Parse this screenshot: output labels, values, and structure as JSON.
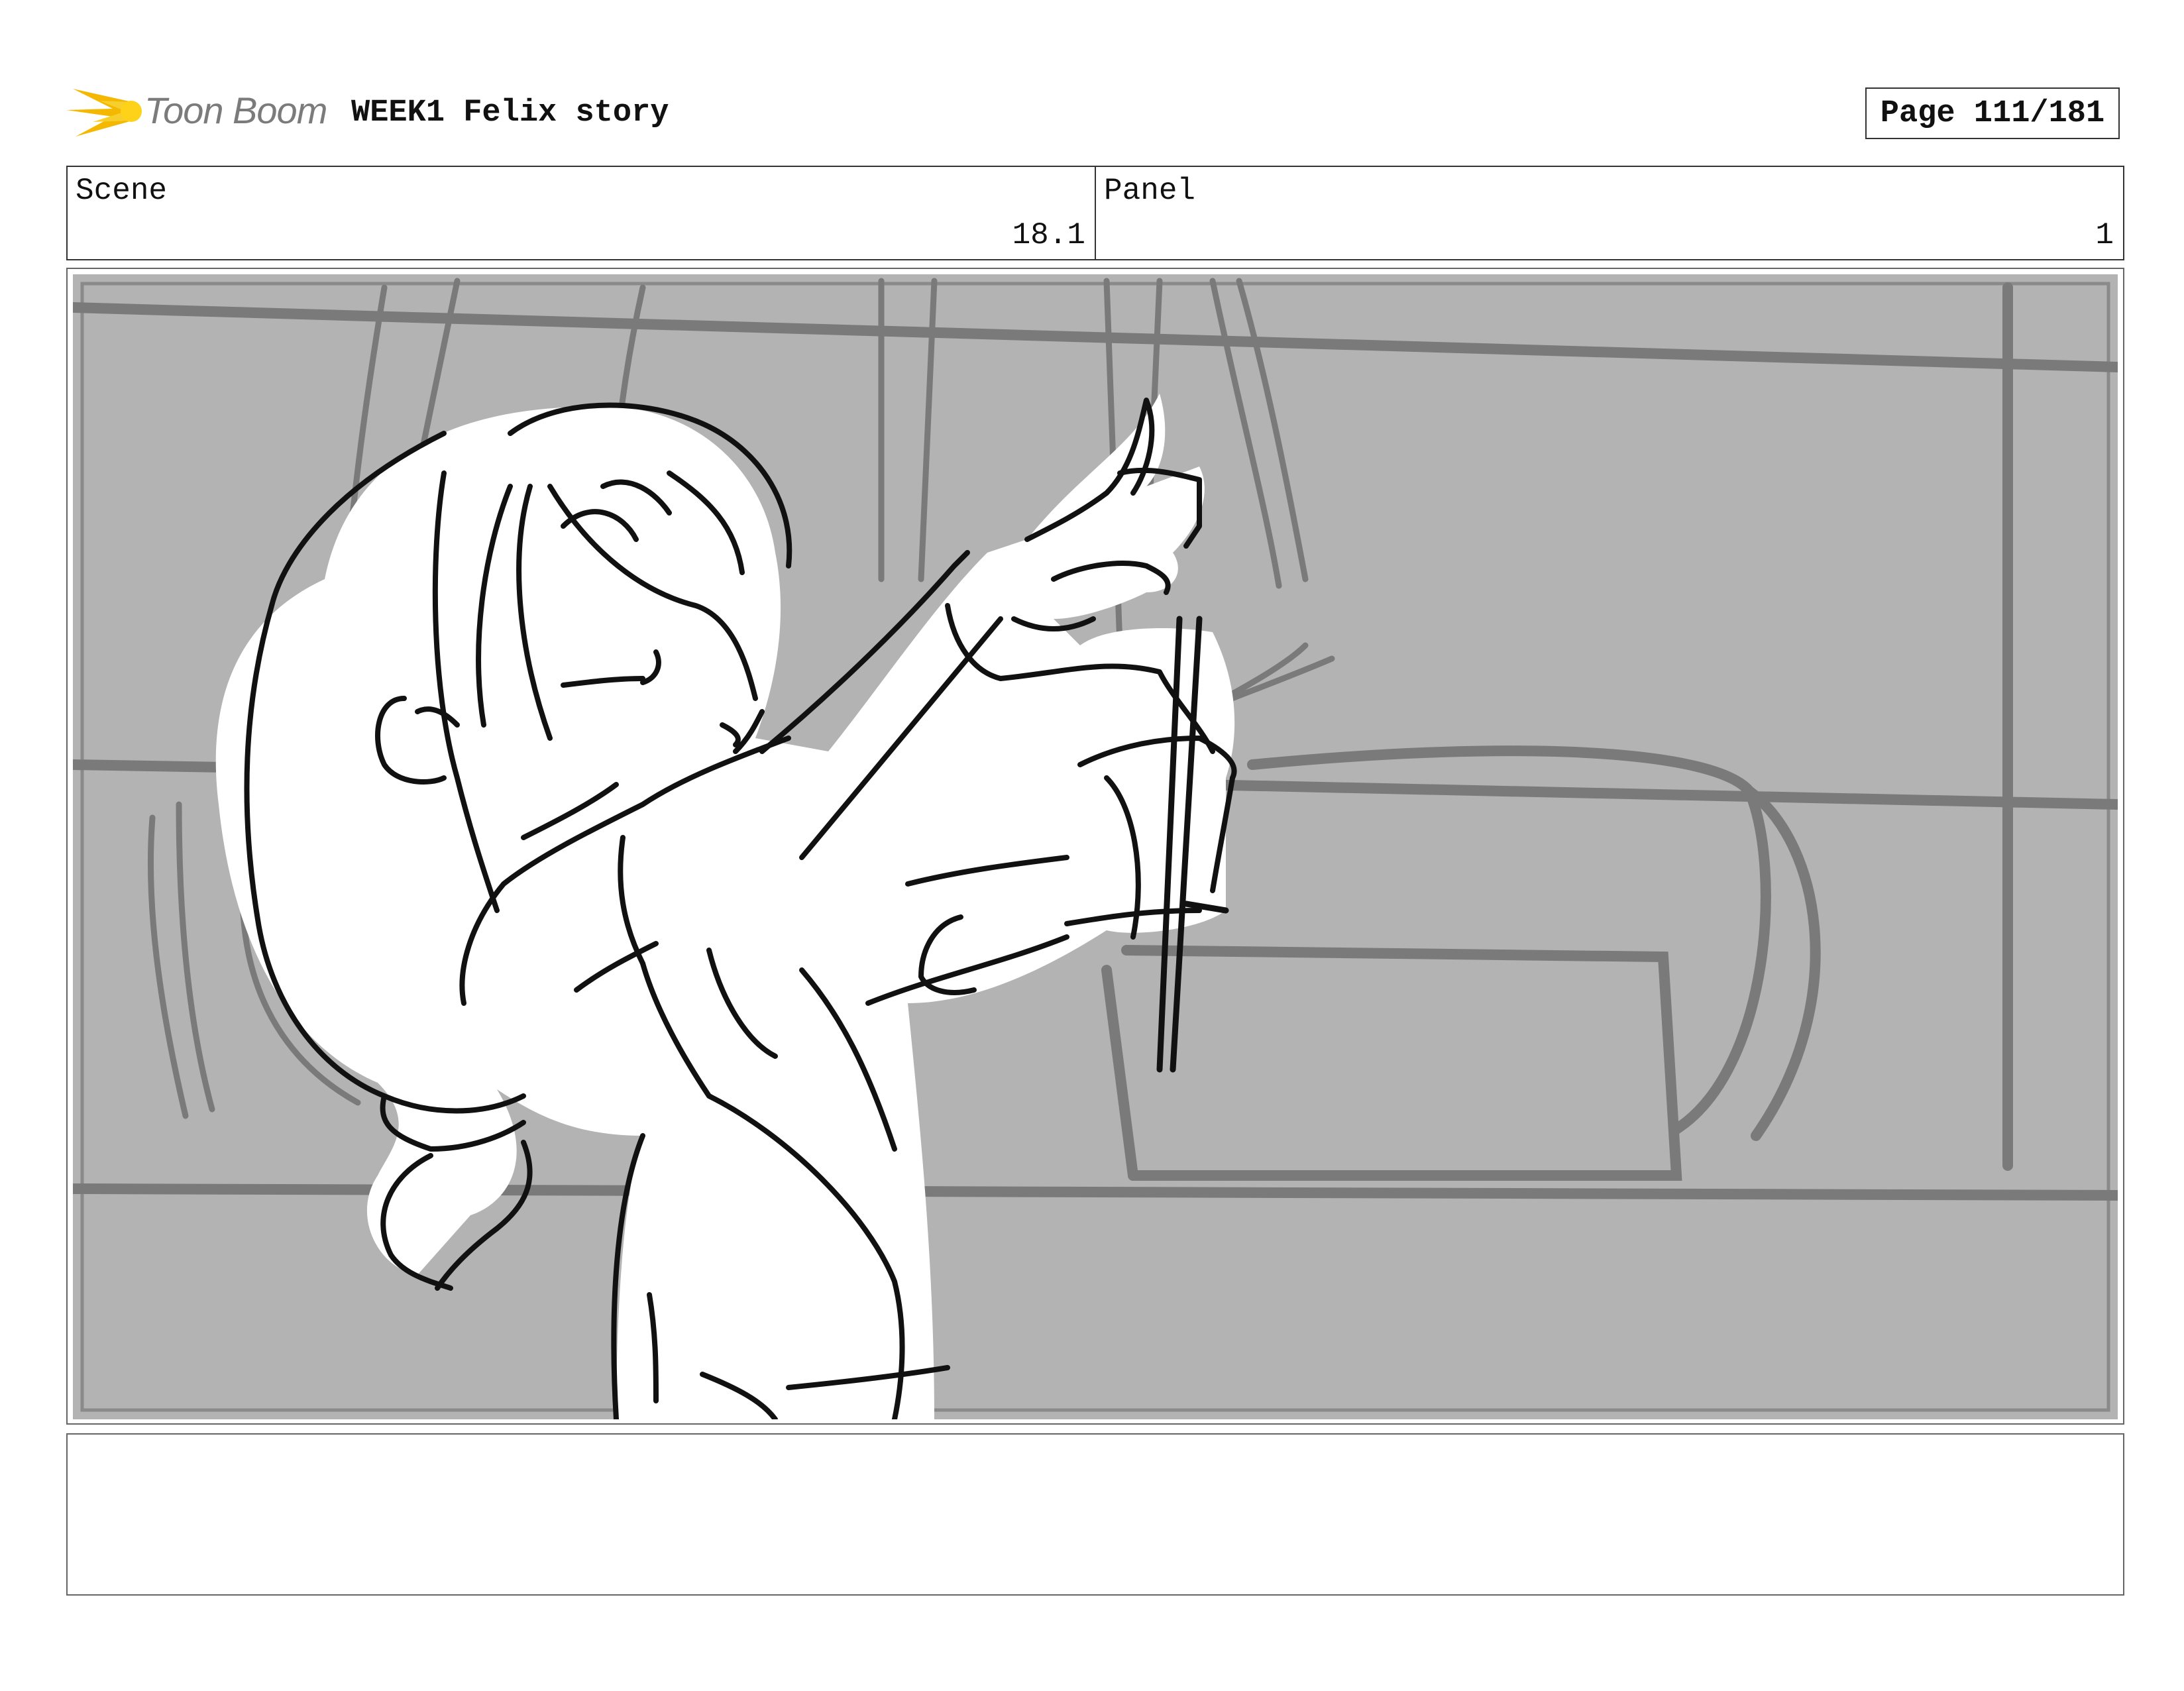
{
  "header": {
    "logo_text": "Toon Boom",
    "project_title": "WEEK1 Felix story",
    "page_label": "Page 111/181"
  },
  "info": {
    "scene_label": "Scene",
    "scene_value": "18.1",
    "panel_label": "Panel",
    "panel_value": "1"
  },
  "panel": {
    "image": "storyboard-sketch",
    "description_icon": "girl-holding-pendulum-sketch"
  },
  "notes": {
    "text": ""
  },
  "colors": {
    "background_gray": "#b3b3b3",
    "line_gray": "#7a7a7a",
    "ink": "#111111",
    "logo_yellow": "#f5b800"
  }
}
